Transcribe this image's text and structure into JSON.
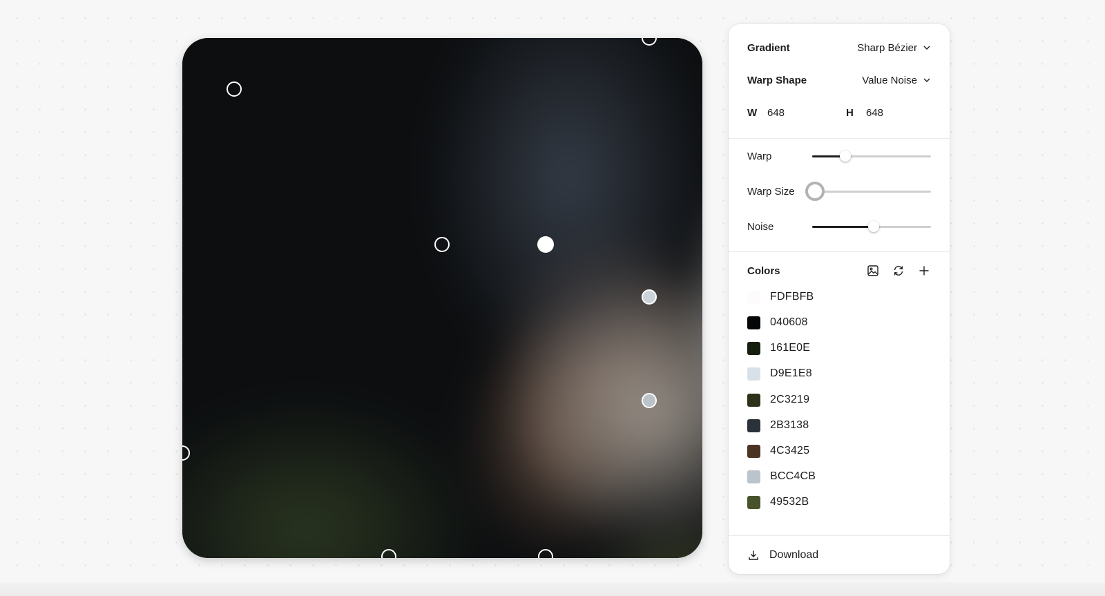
{
  "controls": {
    "gradient": {
      "label": "Gradient",
      "value": "Sharp Bézier"
    },
    "warp_shape": {
      "label": "Warp Shape",
      "value": "Value Noise"
    },
    "width": {
      "label": "W",
      "value": "648"
    },
    "height": {
      "label": "H",
      "value": "648"
    }
  },
  "sliders": [
    {
      "label": "Warp",
      "value": 0.28
    },
    {
      "label": "Warp Size",
      "value": 0.0
    },
    {
      "label": "Noise",
      "value": 0.52
    }
  ],
  "colors": {
    "title": "Colors",
    "icons": [
      "image-icon",
      "refresh-icon",
      "plus-icon"
    ],
    "list": [
      {
        "hex": "FDFBFB",
        "color": "#FDFBFB"
      },
      {
        "hex": "040608",
        "color": "#040608"
      },
      {
        "hex": "161E0E",
        "color": "#161E0E"
      },
      {
        "hex": "D9E1E8",
        "color": "#D9E1E8"
      },
      {
        "hex": "2C3219",
        "color": "#2C3219"
      },
      {
        "hex": "2B3138",
        "color": "#2B3138"
      },
      {
        "hex": "4C3425",
        "color": "#4C3425"
      },
      {
        "hex": "BCC4CB",
        "color": "#BCC4CB"
      },
      {
        "hex": "49532B",
        "color": "#49532B"
      }
    ]
  },
  "download": {
    "label": "Download",
    "icon": "download-icon"
  }
}
